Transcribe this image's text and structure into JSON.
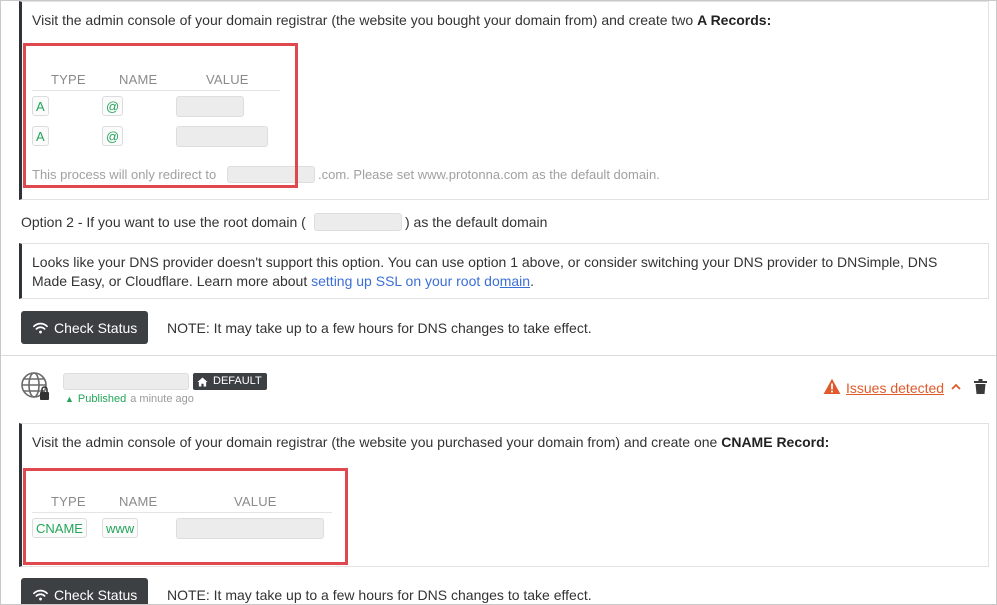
{
  "section1": {
    "instruction_prefix": "Visit the admin console of your domain registrar (the website you bought your domain from) and create two ",
    "instruction_bold": "A Records:",
    "table_headers": [
      "TYPE",
      "NAME",
      "VALUE"
    ],
    "rows": [
      {
        "type": "A",
        "name": "@"
      },
      {
        "type": "A",
        "name": "@"
      }
    ],
    "redirect_prefix": "This process will only redirect to",
    "redirect_suffix": ".com. Please set www.protonna.com as the default domain."
  },
  "option2": {
    "prefix": "Option 2 - If you want to use the root domain (",
    "suffix": ") as the default domain"
  },
  "dns_notice": {
    "line1": "Looks like your DNS provider doesn't support this option. You can use option 1 above, or consider switching your DNS provider to DNSimple, DNS",
    "line2_prefix": "Made Easy, or Cloudflare. Learn more about ",
    "link_text_a": "setting up SSL on your root do",
    "link_text_b": "main",
    "line2_suffix": "."
  },
  "check_status_1": {
    "label": "Check Status",
    "note": "NOTE: It may take up to a few hours for DNS changes to take effect."
  },
  "domain2": {
    "badge_label": "DEFAULT",
    "published_label": "Published",
    "published_time": "a minute ago",
    "issues_label": "Issues detected"
  },
  "section2": {
    "instruction_prefix": "Visit the admin console of your domain registrar (the website you purchased your domain from) and create one ",
    "instruction_bold": "CNAME Record:",
    "table_headers": [
      "TYPE",
      "NAME",
      "VALUE"
    ],
    "rows": [
      {
        "type": "CNAME",
        "name": "www"
      }
    ]
  },
  "check_status_2": {
    "label": "Check Status",
    "note": "NOTE: It may take up to a few hours for DNS changes to take effect."
  },
  "icons": {
    "wifi": "wifi-icon",
    "home": "home-icon",
    "globe": "globe-lock-icon",
    "warning": "warning-icon",
    "chevron": "chevron-up-icon",
    "trash": "trash-icon"
  },
  "colors": {
    "green": "#23a55a",
    "dark": "#3c4043",
    "highlight": "#e0484f",
    "warning": "#e05a2b",
    "link": "#3b6fd6"
  }
}
